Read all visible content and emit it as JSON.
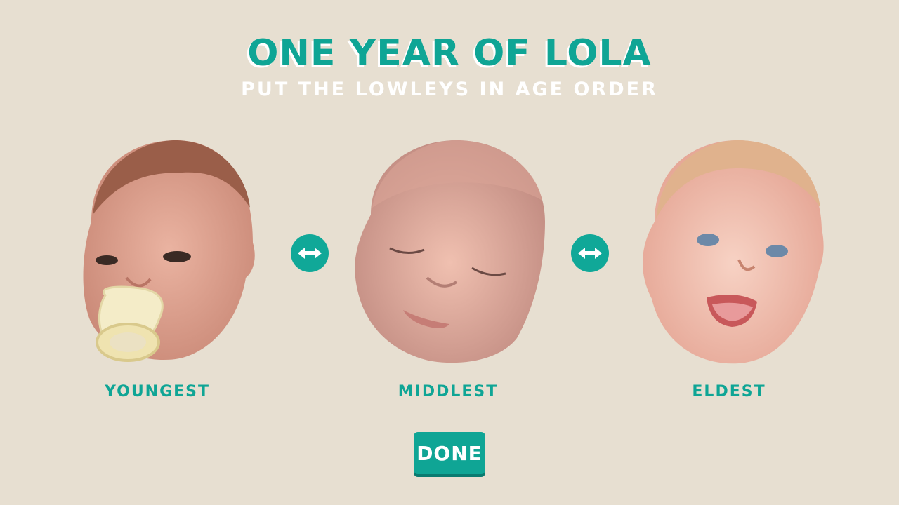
{
  "header": {
    "title": "ONE YEAR OF LOLA",
    "subtitle": "PUT THE LOWLEYS IN AGE ORDER"
  },
  "slots": [
    {
      "label": "YOUNGEST",
      "photo": "newborn-face-with-pacifier"
    },
    {
      "label": "MIDDLEST",
      "photo": "sleeping-baby-face"
    },
    {
      "label": "ELDEST",
      "photo": "smiling-baby-face"
    }
  ],
  "swap_icon": "left-right-arrows-icon",
  "done_button": {
    "label": "DONE"
  },
  "colors": {
    "background": "#e7dfd1",
    "accent": "#0fa595",
    "button_shadow": "#0a7b70",
    "subtitle": "#ffffff"
  }
}
